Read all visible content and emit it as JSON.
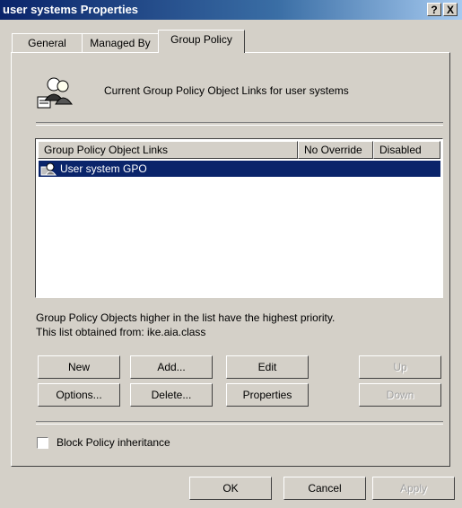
{
  "window": {
    "title": "user systems Properties",
    "help_btn": "?",
    "close_btn": "X"
  },
  "tabs": [
    {
      "label": "General",
      "active": false
    },
    {
      "label": "Managed By",
      "active": false
    },
    {
      "label": "Group Policy",
      "active": true
    }
  ],
  "header": {
    "text": "Current Group Policy Object Links for user systems",
    "icon": "users-group-icon"
  },
  "list": {
    "columns": [
      "Group Policy Object Links",
      "No Override",
      "Disabled"
    ],
    "rows": [
      {
        "name": "User system GPO",
        "no_override": "",
        "disabled": "",
        "selected": true,
        "icon": "gpo-icon"
      }
    ]
  },
  "info": {
    "priority": "Group Policy Objects higher in the list have the highest priority.",
    "obtained": "This list obtained from: ike.aia.class"
  },
  "buttons": {
    "new": "New",
    "add": "Add...",
    "edit": "Edit",
    "up": "Up",
    "options": "Options...",
    "delete": "Delete...",
    "properties": "Properties",
    "down": "Down"
  },
  "block": {
    "label": "Block Policy inheritance",
    "checked": false
  },
  "footer": {
    "ok": "OK",
    "cancel": "Cancel",
    "apply": "Apply"
  },
  "colors": {
    "titlebar": "#0a246a",
    "face": "#d4d0c8",
    "selection": "#0a246a"
  }
}
